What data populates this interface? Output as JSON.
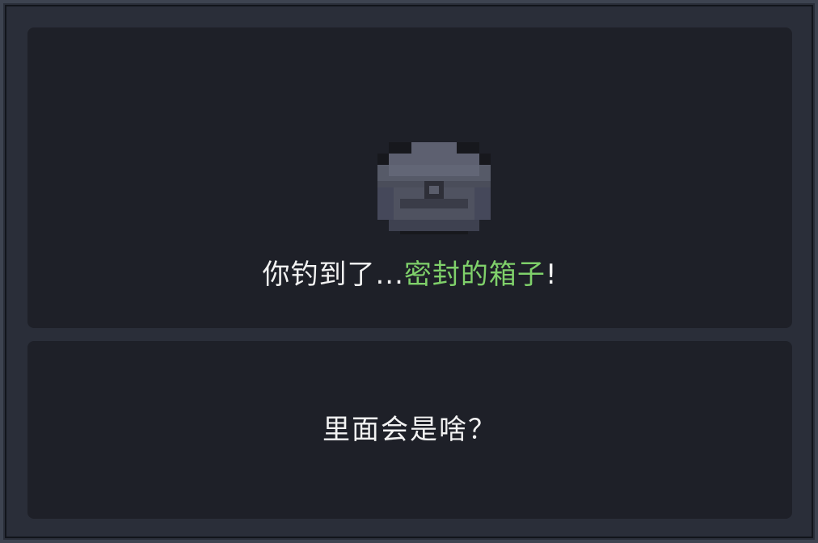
{
  "dialog": {
    "catch_message": {
      "prefix": "你钓到了...",
      "item_name": "密封的箱子",
      "suffix": "!"
    },
    "question": "里面会是啥？",
    "item_icon": "sealed-chest-icon"
  },
  "colors": {
    "frame": "#2a2e39",
    "panel": "#1e2028",
    "text": "#f2f2f2",
    "item_highlight": "#7fd06a",
    "chest_body": "#4f5260",
    "chest_shadow": "#2e2f38"
  }
}
